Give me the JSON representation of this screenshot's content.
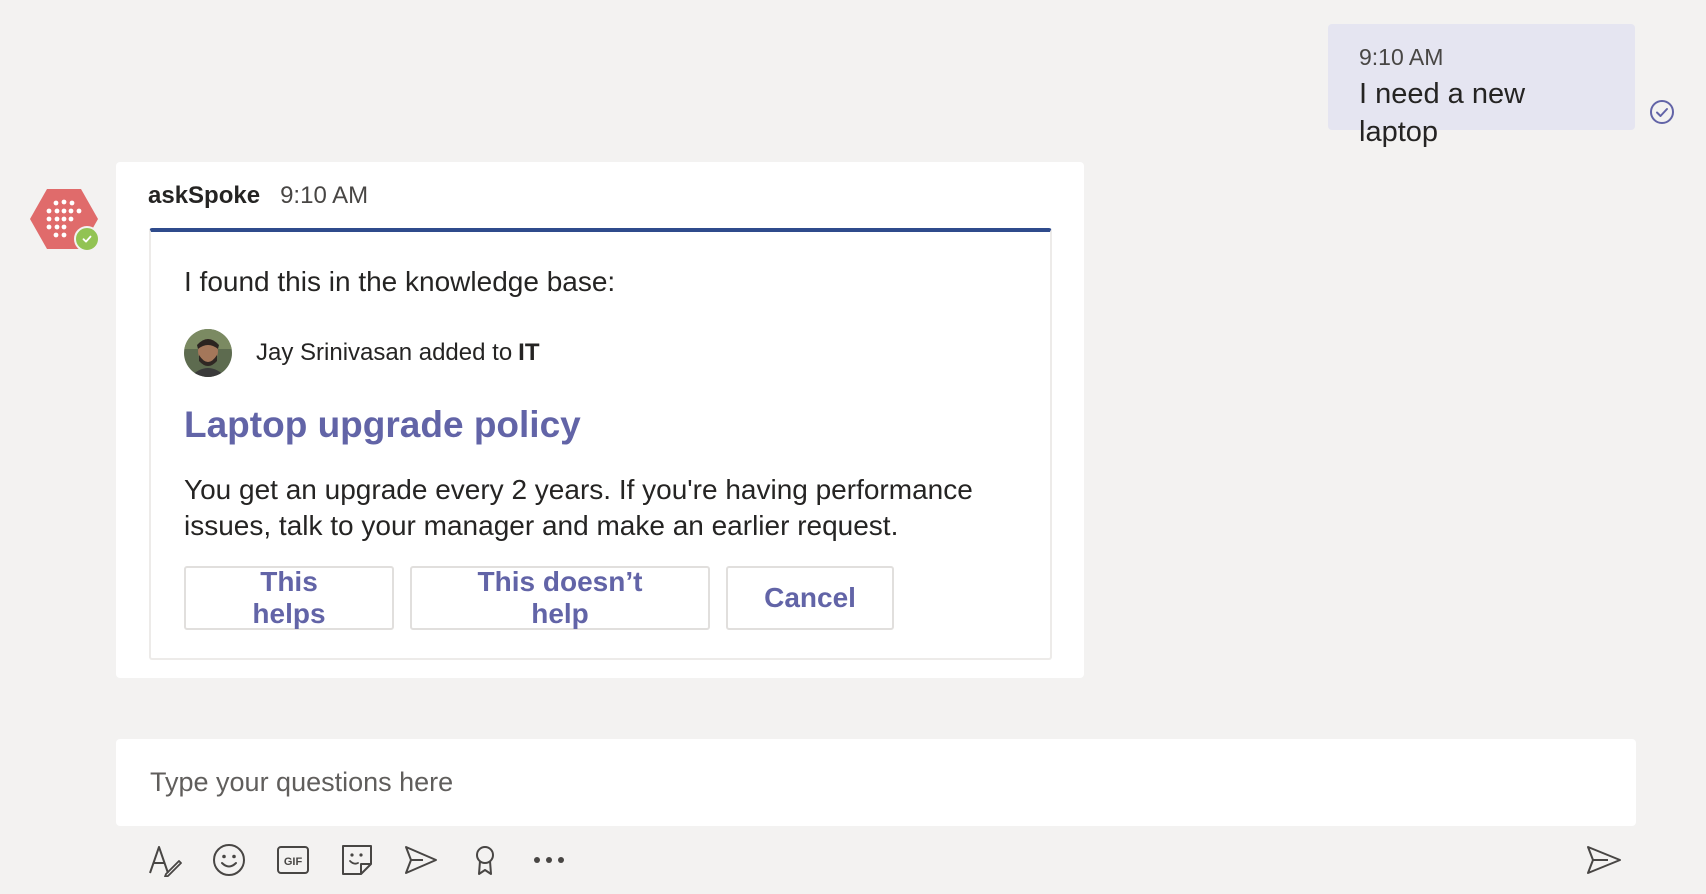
{
  "outgoing": {
    "time": "9:10 AM",
    "text": "I need a new laptop"
  },
  "incoming": {
    "sender": "askSpoke",
    "time": "9:10 AM",
    "card": {
      "intro": "I found this in the knowledge base:",
      "author": "Jay Srinivasan added to",
      "team": "IT",
      "title": "Laptop upgrade policy",
      "body": "You get an upgrade every 2 years. If you're having performance issues, talk to your manager and make an earlier request.",
      "actions": {
        "helps": "This helps",
        "not_helps": "This doesn’t help",
        "cancel": "Cancel"
      }
    }
  },
  "compose": {
    "placeholder": "Type your questions here"
  },
  "toolbar": {
    "icons": [
      "format-icon",
      "emoji-icon",
      "gif-icon",
      "sticker-icon",
      "meet-icon",
      "praise-icon",
      "more-icon"
    ],
    "gif_text": "GIF"
  },
  "colors": {
    "accent": "#6264a7",
    "card_border_top": "#2f4b8c",
    "bot_avatar": "#e06b6b",
    "presence": "#92c353",
    "outgoing_bubble": "#e5e5f1",
    "background": "#f3f2f1"
  }
}
